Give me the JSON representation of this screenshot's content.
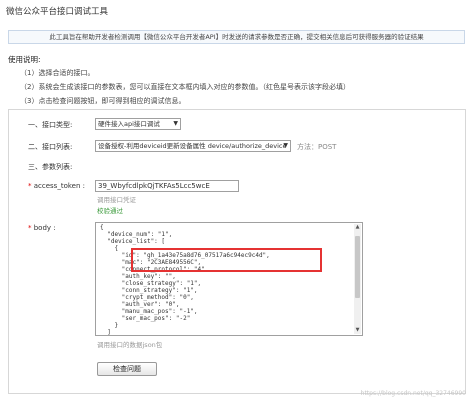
{
  "page": {
    "title": "微信公众平台接口调试工具",
    "notice": "此工具旨在帮助开发者检测调用【微信公众平台开发者API】时发送的请求参数是否正确，提交相关信息后可获得服务器的验证结果",
    "help_heading": "使用说明:",
    "help_lines": [
      "（1）选择合适的接口。",
      "（2）系统会生成该接口的参数表，您可以直接在文本框内填入对应的参数值。（红色星号表示该字段必填）",
      "（3）点击检查问题按钮，即可得到相应的调试信息。"
    ]
  },
  "form": {
    "interface_type": {
      "label": "一、接口类型:",
      "value": "硬件接入api接口调试"
    },
    "interface_list": {
      "label": "二、接口列表:",
      "value": "设备授权-利用deviceid更新设备属性 device/authorize_device",
      "method": "方法：POST"
    },
    "params_label": "三、参数列表:",
    "access_token": {
      "star": "*",
      "label": "access_token :",
      "value": "39_WbyfcdlpkQjTKFAs5Lcc5wcE",
      "hint": "调用接口凭证",
      "status": "校验通过"
    },
    "body": {
      "star": "*",
      "label": "body :",
      "lines": [
        "{",
        "  \"device_num\": \"1\",",
        "  \"device_list\": [",
        "    {",
        "      \"id\": \"gh_1a43e75a8d76_07517a6c94ec9c4d\",",
        "      \"mac\": \"2C3AE849556C\",",
        "      \"connect_protocol\": \"4\",",
        "      \"auth_key\": \"\",",
        "      \"close_strategy\": \"1\",",
        "      \"conn_strategy\": \"1\",",
        "      \"crypt_method\": \"0\",",
        "      \"auth_ver\": \"0\",",
        "      \"manu_mac_pos\": \"-1\",",
        "      \"ser_mac_pos\": \"-2\"",
        "    }",
        "  ]"
      ],
      "hint": "调用接口的数据json包"
    },
    "check_button": "检查问题"
  },
  "watermark": "https://blog.csdn.net/qq_32746990",
  "icons": {
    "dropdown": "chevron-down-icon",
    "scroll_up": "scroll-up-arrow-icon",
    "scroll_down": "scroll-down-arrow-icon"
  },
  "colors": {
    "highlight": "#e53232",
    "success": "#3a9a3a",
    "required": "#dd0000"
  }
}
